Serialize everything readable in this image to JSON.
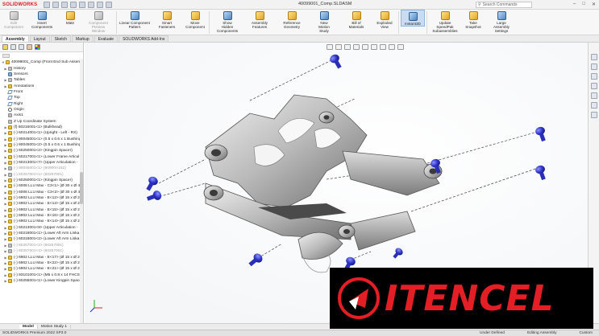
{
  "titlebar": {
    "app_name": "SOLIDWORKS",
    "doc_title": "40099001_Comp.SLDASM",
    "search_placeholder": "Search Commands",
    "min": "–",
    "max": "□",
    "close": "✕"
  },
  "commands": [
    {
      "label": "Edit\nComponent",
      "disabled": true,
      "icon": "edit-component-icon"
    },
    {
      "label": "Insert\nComponents",
      "icon": "insert-components-icon"
    },
    {
      "label": "Mate",
      "icon": "mate-icon"
    },
    {
      "label": "Component\nPreview\nWindow",
      "disabled": true,
      "icon": "component-preview-icon"
    },
    {
      "label": "Linear Component\nPattern",
      "icon": "linear-pattern-icon"
    },
    {
      "label": "Smart\nFasteners",
      "icon": "smart-fasteners-icon"
    },
    {
      "label": "Move\nComponent",
      "icon": "move-component-icon"
    },
    {
      "label": "Show\nHidden\nComponents",
      "icon": "show-hidden-icon"
    },
    {
      "label": "Assembly\nFeatures",
      "icon": "assembly-features-icon"
    },
    {
      "label": "Reference\nGeometry",
      "icon": "reference-geometry-icon"
    },
    {
      "label": "New\nMotion\nStudy",
      "icon": "motion-study-icon"
    },
    {
      "label": "Bill of\nMaterials",
      "icon": "bom-icon"
    },
    {
      "label": "Exploded\nView",
      "icon": "exploded-view-icon"
    },
    {
      "label": "Instant3D",
      "active": true,
      "icon": "instant3d-icon"
    },
    {
      "label": "Update\nSpeedPak\nSubassemblies",
      "icon": "speedpak-icon"
    },
    {
      "label": "Take\nSnapshot",
      "icon": "snapshot-icon"
    },
    {
      "label": "Large\nAssembly\nSettings",
      "icon": "large-assembly-icon"
    }
  ],
  "tabs": [
    "Assembly",
    "Layout",
    "Sketch",
    "Markup",
    "Evaluate",
    "SOLIDWORKS Add-Ins"
  ],
  "active_tab": "Assembly",
  "tree": [
    {
      "text": "40099001_Comp (Front End Sub Assembly",
      "icon": "yellow",
      "toggle": "▼",
      "indent": 0
    },
    {
      "text": "History",
      "icon": "gray",
      "toggle": "▶",
      "indent": 1
    },
    {
      "text": "Sensors",
      "icon": "blue",
      "toggle": "",
      "indent": 1
    },
    {
      "text": "Tables",
      "icon": "gray",
      "toggle": "▶",
      "indent": 1
    },
    {
      "text": "Annotations",
      "icon": "yellow",
      "toggle": "▶",
      "indent": 1
    },
    {
      "text": "Front",
      "icon": "plane",
      "toggle": "",
      "indent": 1
    },
    {
      "text": "Top",
      "icon": "plane",
      "toggle": "",
      "indent": 1
    },
    {
      "text": "Right",
      "icon": "plane",
      "toggle": "",
      "indent": 1
    },
    {
      "text": "Origin",
      "icon": "origin",
      "toggle": "",
      "indent": 1
    },
    {
      "text": "Axis1",
      "icon": "gray",
      "toggle": "",
      "indent": 1
    },
    {
      "text": "Z Up Coordinate System",
      "icon": "gray",
      "toggle": "",
      "indent": 1
    },
    {
      "text": "(f) 60216001<1> (Bulkhead)",
      "icon": "yellow",
      "toggle": "▶",
      "indent": 1
    },
    {
      "text": "(-) 60214001<1> (Upright - Left - RX)",
      "icon": "yellow",
      "toggle": "▶",
      "indent": 1
    },
    {
      "text": "(-) 90045001<1> (0.5 x 0.6 x 1 Bushing",
      "icon": "yellow",
      "toggle": "▶",
      "indent": 1
    },
    {
      "text": "(-) 90045001<2> (0.5 x 0.6 x 1 Bushing",
      "icon": "yellow",
      "toggle": "▶",
      "indent": 1
    },
    {
      "text": "(-) 60250001<2> (Kingpin Spacer)",
      "icon": "yellow",
      "toggle": "▶",
      "indent": 1
    },
    {
      "text": "(-) 60217001<1> (Lower Frame Articul",
      "icon": "yellow",
      "toggle": "▶",
      "indent": 1
    },
    {
      "text": "(-) 60213001<7> (Upper Articulation -",
      "icon": "yellow",
      "toggle": "▶",
      "indent": 1
    },
    {
      "text": "(-) 90045001<1> (90900A152)",
      "icon": "gray",
      "toggle": "▶",
      "indent": 1,
      "suppressed": true
    },
    {
      "text": "(-) 60257001<1> (60257001)",
      "icon": "gray",
      "toggle": "▶",
      "indent": 1,
      "suppressed": true
    },
    {
      "text": "(-) 60250001<1> (Kingpin Spacer)",
      "icon": "yellow",
      "toggle": "▶",
      "indent": 1
    },
    {
      "text": "(-) 6006 LLU Max - C3<1> (Ø 30 x Ø 42",
      "icon": "yellow",
      "toggle": "▶",
      "indent": 1
    },
    {
      "text": "(-) 6006 LLU Max - C3<2> (Ø 30 x Ø 42",
      "icon": "yellow",
      "toggle": "▶",
      "indent": 1
    },
    {
      "text": "(-) 6902 LLU Max - E<12> (Ø 15 x Ø 2",
      "icon": "yellow",
      "toggle": "▶",
      "indent": 1
    },
    {
      "text": "(-) 6902 LLU Max - E<13> (Ø 15 x Ø 2",
      "icon": "yellow",
      "toggle": "▶",
      "indent": 1
    },
    {
      "text": "(-) 6902 LLU Max - E<15> (Ø 15 x Ø 2",
      "icon": "yellow",
      "toggle": "▶",
      "indent": 1
    },
    {
      "text": "(-) 6902 LLU Max - E<16> (Ø 15 x Ø 2",
      "icon": "yellow",
      "toggle": "▶",
      "indent": 1
    },
    {
      "text": "(-) 6902 LLU Max - E<14> (Ø 15 x Ø 2",
      "icon": "yellow",
      "toggle": "▶",
      "indent": 1
    },
    {
      "text": "(-) 60213001<8> (Upper Articulation -",
      "icon": "yellow",
      "toggle": "▶",
      "indent": 1
    },
    {
      "text": "(-) 60218001<1> (Lower Aft Arm Linka",
      "icon": "yellow",
      "toggle": "▶",
      "indent": 1
    },
    {
      "text": "(-) 60218001<2> (Lower Aft Arm Linka",
      "icon": "yellow",
      "toggle": "▶",
      "indent": 1
    },
    {
      "text": "(-) 60257001<2> (60257001)",
      "icon": "gray",
      "toggle": "▶",
      "indent": 1,
      "suppressed": true
    },
    {
      "text": "(-) 60257001<4> (60257001)",
      "icon": "gray",
      "toggle": "▶",
      "indent": 1,
      "suppressed": true
    },
    {
      "text": "(-) 6902 LLU Max - E<17> (Ø 15 x Ø 2",
      "icon": "yellow",
      "toggle": "▶",
      "indent": 1
    },
    {
      "text": "(-) 6902 LLU Max - E<22> (Ø 15 x Ø 2",
      "icon": "yellow",
      "toggle": "▶",
      "indent": 1
    },
    {
      "text": "(-) 6902 LLU Max - E<21> (Ø 15 x Ø 2",
      "icon": "yellow",
      "toggle": "▶",
      "indent": 1
    },
    {
      "text": "(-) 93101001<1> (M5 x 0.8 x 14 FHCS)",
      "icon": "yellow",
      "toggle": "▶",
      "indent": 1
    },
    {
      "text": "(-) 60255001<1> (Lower Kingpin Space",
      "icon": "yellow",
      "toggle": "▶",
      "indent": 1
    }
  ],
  "bottom_tabs": [
    "Model",
    "Motion Study 1"
  ],
  "active_bottom_tab": "Model",
  "status": {
    "left": "SOLIDWORKS Premium 2022 SP3.0",
    "under_defined": "Under Defined",
    "editing": "Editing Assembly",
    "custom": "Custom"
  },
  "watermark": {
    "text": "ITENCEL"
  },
  "colors": {
    "accent": "#d71920",
    "bolt": "#3a3fd6",
    "logo_red": "#e31e24"
  }
}
